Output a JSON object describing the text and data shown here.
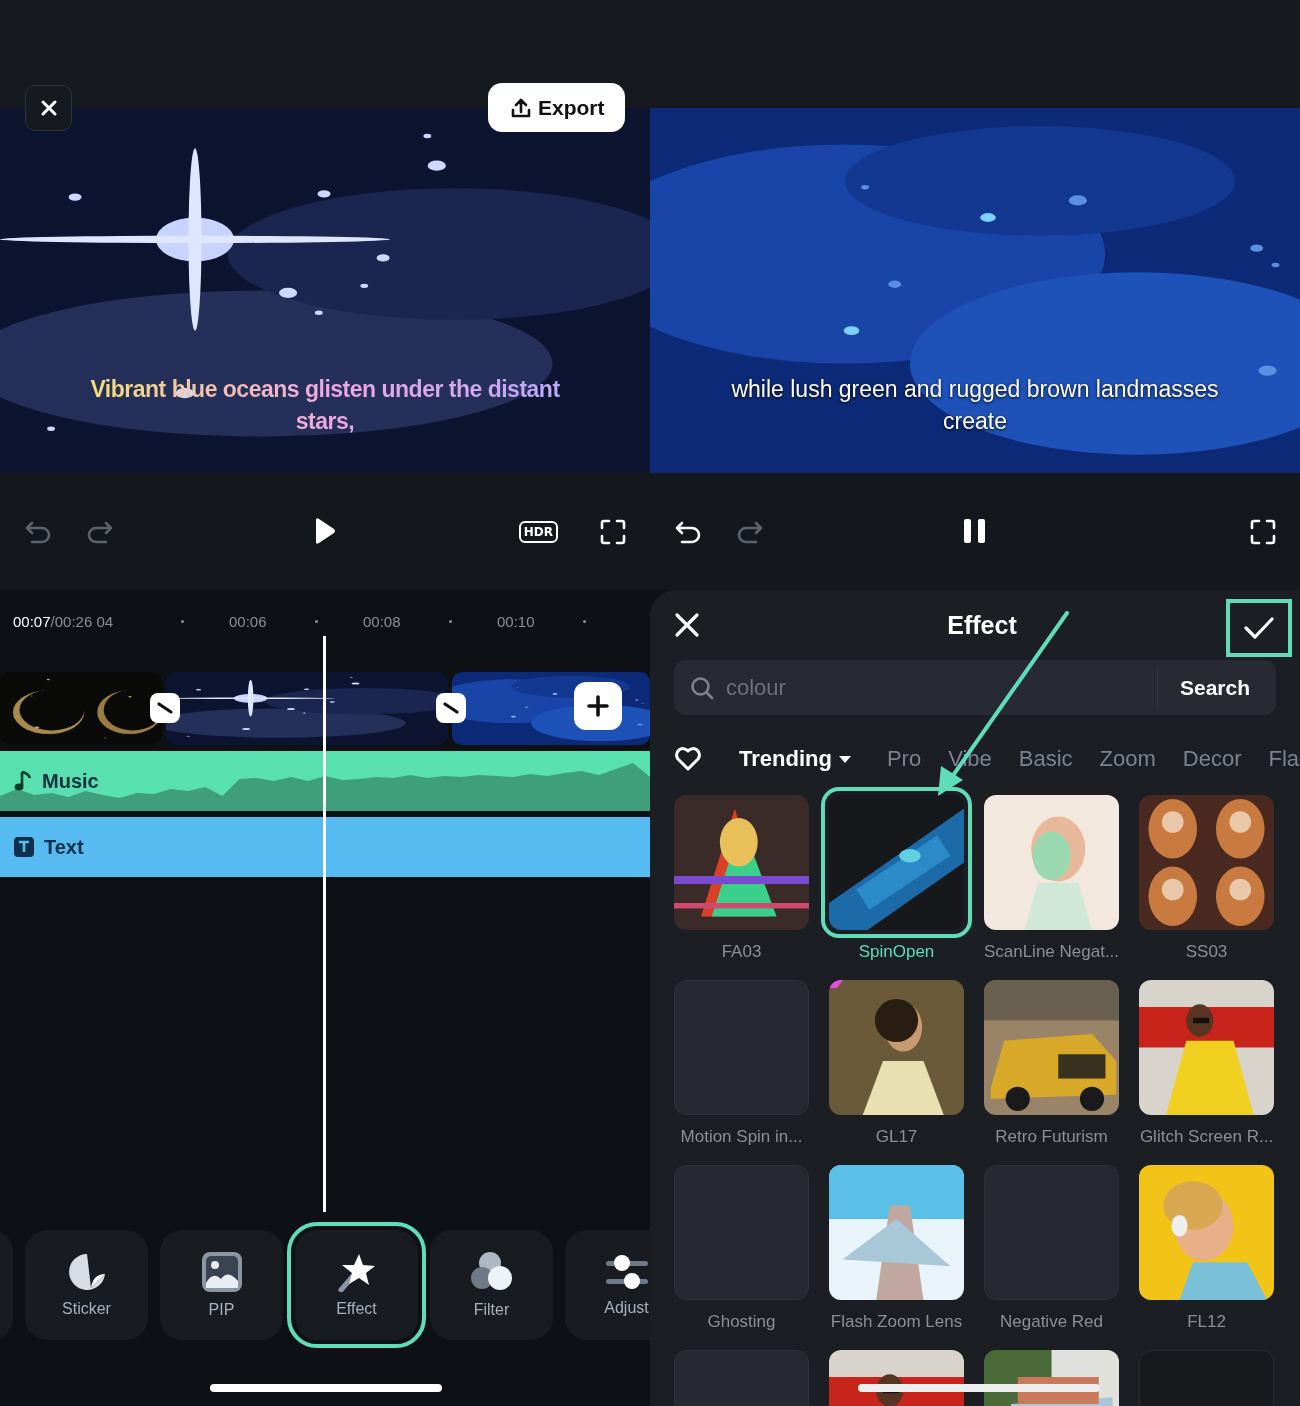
{
  "left_screen": {
    "export_button": {
      "label": "Export"
    },
    "caption": "Vibrant blue oceans glisten under the distant stars,",
    "controls": {
      "undo_enabled": false,
      "redo_enabled": false,
      "playing": false,
      "hdr_label": "HDR"
    },
    "timeline": {
      "current_time": "00:07",
      "total_time": "/00:26 04",
      "ticks": [
        "00:06",
        "00:08",
        "00:10"
      ],
      "tracks": [
        {
          "kind": "music",
          "label": "Music"
        },
        {
          "kind": "text",
          "label": "Text"
        }
      ]
    },
    "toolbar": [
      {
        "kind": "blank",
        "highlighted": false
      },
      {
        "kind": "sticker",
        "label": "Sticker",
        "highlighted": false
      },
      {
        "kind": "pip",
        "label": "PIP",
        "highlighted": false
      },
      {
        "kind": "effect",
        "label": "Effect",
        "highlighted": true
      },
      {
        "kind": "filter",
        "label": "Filter",
        "highlighted": false
      },
      {
        "kind": "adjust",
        "label": "Adjust",
        "highlighted": false
      }
    ]
  },
  "right_screen": {
    "caption": "while lush green and rugged brown landmasses create",
    "controls": {
      "undo_enabled": true,
      "redo_enabled": false,
      "playing": true
    },
    "effect_panel": {
      "title": "Effect",
      "confirm_highlighted": true,
      "search": {
        "placeholder": "colour",
        "button": "Search"
      },
      "categories": [
        {
          "label": "Trending",
          "selected": true
        },
        {
          "label": "Pro",
          "selected": false
        },
        {
          "label": "Vibe",
          "selected": false
        },
        {
          "label": "Basic",
          "selected": false
        },
        {
          "label": "Zoom",
          "selected": false
        },
        {
          "label": "Decor",
          "selected": false
        },
        {
          "label": "Fla",
          "selected": false
        }
      ],
      "effects": [
        {
          "name": "FA03",
          "kind": "picture",
          "selected": false,
          "corner_mark": false
        },
        {
          "name": "SpinOpen",
          "kind": "picture",
          "selected": true,
          "corner_mark": false
        },
        {
          "name": "ScanLine Negat...",
          "kind": "picture",
          "selected": false,
          "corner_mark": false
        },
        {
          "name": "SS03",
          "kind": "picture",
          "selected": false,
          "corner_mark": false
        },
        {
          "name": "Motion Spin in...",
          "kind": "empty",
          "selected": false,
          "corner_mark": false
        },
        {
          "name": "GL17",
          "kind": "picture",
          "selected": false,
          "corner_mark": true
        },
        {
          "name": "Retro Futurism",
          "kind": "picture",
          "selected": false,
          "corner_mark": false
        },
        {
          "name": "Glitch Screen R...",
          "kind": "picture",
          "selected": false,
          "corner_mark": false
        },
        {
          "name": "Ghosting",
          "kind": "empty",
          "selected": false,
          "corner_mark": false
        },
        {
          "name": "Flash Zoom Lens",
          "kind": "picture",
          "selected": false,
          "corner_mark": false
        },
        {
          "name": "Negative Red",
          "kind": "empty",
          "selected": false,
          "corner_mark": false
        },
        {
          "name": "FL12",
          "kind": "picture",
          "selected": false,
          "corner_mark": false
        },
        {
          "kind": "empty",
          "selected": false,
          "corner_mark": false
        },
        {
          "kind": "picture",
          "selected": false,
          "corner_mark": false
        },
        {
          "kind": "picture",
          "selected": false,
          "corner_mark": false
        },
        {
          "kind": "dark",
          "selected": false,
          "corner_mark": false
        }
      ]
    }
  }
}
